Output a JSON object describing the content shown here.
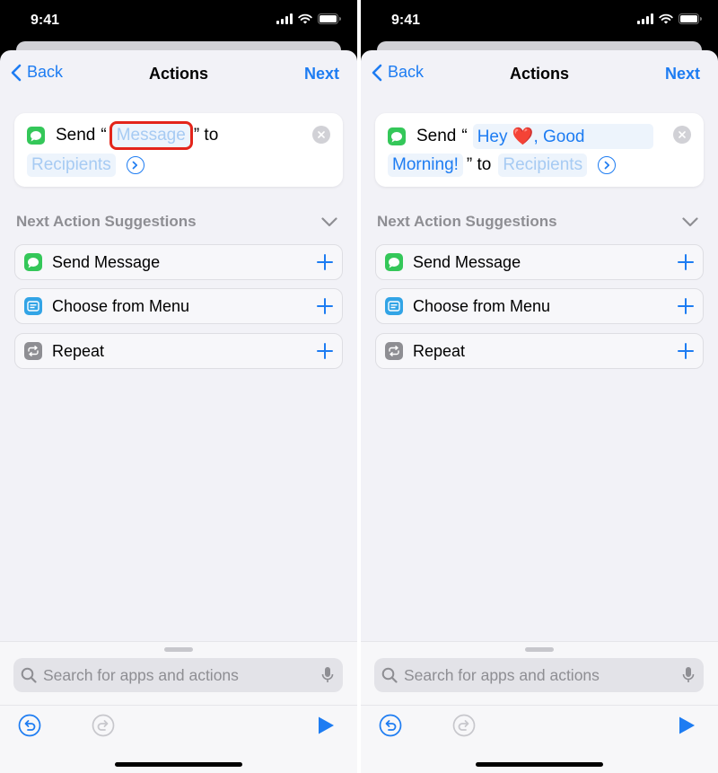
{
  "status_bar": {
    "time": "9:41"
  },
  "colors": {
    "accent": "#1d7cf2",
    "messages_green": "#34c759",
    "menu_blue": "#32a4e6",
    "repeat_gray": "#8e8e93",
    "highlight_red": "#e3251b"
  },
  "nav": {
    "back_label": "Back",
    "title": "Actions",
    "next_label": "Next"
  },
  "screens": [
    {
      "action": {
        "verb": "Send",
        "open_quote": "“",
        "message": "Message",
        "close_quote": "” to",
        "recipients": "Recipients"
      }
    },
    {
      "action": {
        "verb": "Send",
        "open_quote": "“",
        "message_part1": "Hey",
        "heart": "❤️",
        "message_part2": ", Good",
        "message_part3": "Morning!",
        "close_quote": "” to",
        "recipients": "Recipients"
      }
    }
  ],
  "suggestions": {
    "title": "Next Action Suggestions",
    "items": [
      {
        "label": "Send Message",
        "icon": "messages-icon"
      },
      {
        "label": "Choose from Menu",
        "icon": "menu-icon"
      },
      {
        "label": "Repeat",
        "icon": "repeat-icon"
      }
    ]
  },
  "search": {
    "placeholder": "Search for apps and actions"
  }
}
